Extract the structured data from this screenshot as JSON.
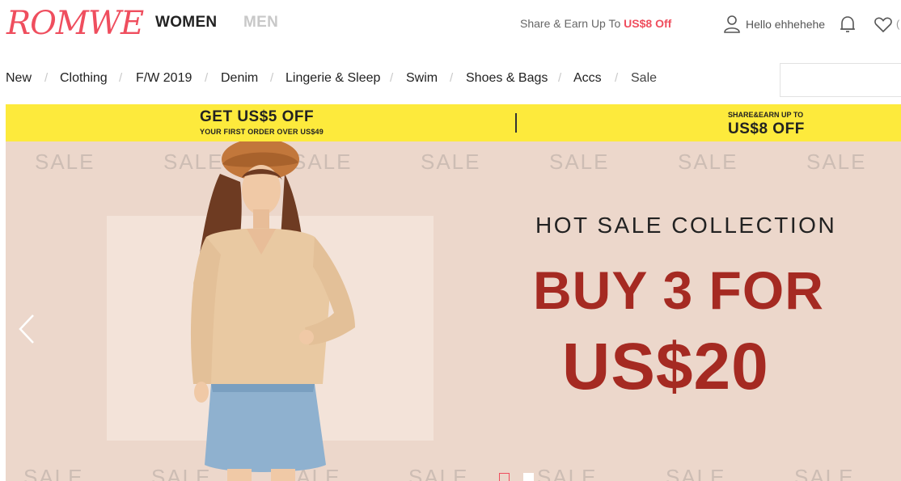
{
  "header": {
    "logo": "ROMWE",
    "gender_tabs": [
      "WOMEN",
      "MEN"
    ],
    "share_prefix": "Share & Earn Up To ",
    "share_amount": "US$8 Off",
    "greeting": "Hello ehhehehe",
    "icons": [
      "user-icon",
      "bell-icon",
      "heart-icon"
    ]
  },
  "nav": {
    "items": [
      "New",
      "Clothing",
      "F/W 2019",
      "Denim",
      "Lingerie & Sleep",
      "Swim",
      "Shoes & Bags",
      "Accs",
      "Sale"
    ],
    "separator": "/"
  },
  "search": {
    "placeholder": "",
    "value": ""
  },
  "promo": {
    "left_line1": "GET US$5 OFF",
    "left_line2": "YOUR FIRST ORDER OVER US$49",
    "right_line1": "SHARE&EARN UP TO",
    "right_line2": "US$8 OFF"
  },
  "banner": {
    "watermark": "SALE",
    "headline": "HOT SALE COLLECTION",
    "offer_line1": "BUY 3 FOR",
    "offer_line2": "US$20",
    "slide_count": 2,
    "active_slide": 1
  },
  "colors": {
    "brand": "#ef4e5e",
    "promo_bg": "#fdea3c",
    "banner_bg": "#ecd7cb",
    "offer": "#a52a22"
  }
}
